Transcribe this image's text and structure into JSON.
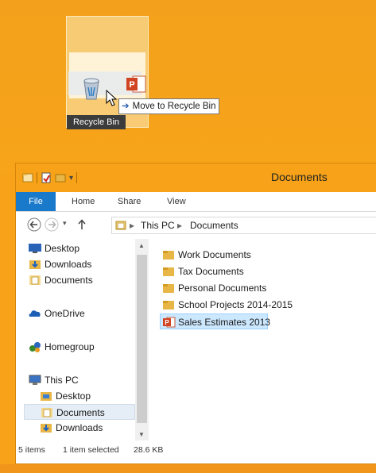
{
  "desktop": {
    "recycle_bin_label": "Recycle Bin",
    "drag_tooltip": "Move to Recycle Bin",
    "drag_tooltip_arrow": "➔"
  },
  "window": {
    "title": "Documents",
    "ribbon_tabs": [
      "File",
      "Home",
      "Share",
      "View"
    ],
    "breadcrumb": [
      "This PC",
      "Documents"
    ],
    "breadcrumb_separator": "▸"
  },
  "nav_pane": {
    "items": [
      {
        "label": "Desktop",
        "icon": "desktop-icon"
      },
      {
        "label": "Downloads",
        "icon": "downloads-icon"
      },
      {
        "label": "Documents",
        "icon": "documents-icon"
      },
      {
        "label": "OneDrive",
        "icon": "onedrive-icon"
      },
      {
        "label": "Homegroup",
        "icon": "homegroup-icon"
      },
      {
        "label": "This PC",
        "icon": "computer-icon"
      },
      {
        "label": "Desktop",
        "icon": "desktop-folder-icon"
      },
      {
        "label": "Documents",
        "icon": "documents-icon"
      },
      {
        "label": "Downloads",
        "icon": "downloads-icon"
      }
    ],
    "selected": "Documents"
  },
  "files": {
    "items": [
      {
        "name": "Work Documents",
        "type": "folder"
      },
      {
        "name": "Tax Documents",
        "type": "folder"
      },
      {
        "name": "Personal Documents",
        "type": "folder"
      },
      {
        "name": "School Projects 2014-2015",
        "type": "folder"
      },
      {
        "name": "Sales Estimates 2013",
        "type": "powerpoint"
      }
    ],
    "selected": "Sales Estimates 2013"
  },
  "status": {
    "item_count": "5 items",
    "selection": "1 item selected",
    "size": "28.6 KB"
  },
  "colors": {
    "desktop": "#f7a219",
    "file_tab": "#1979ca",
    "selection": "#cce8ff",
    "folder": "#e8b647",
    "powerpoint": "#d04423"
  }
}
